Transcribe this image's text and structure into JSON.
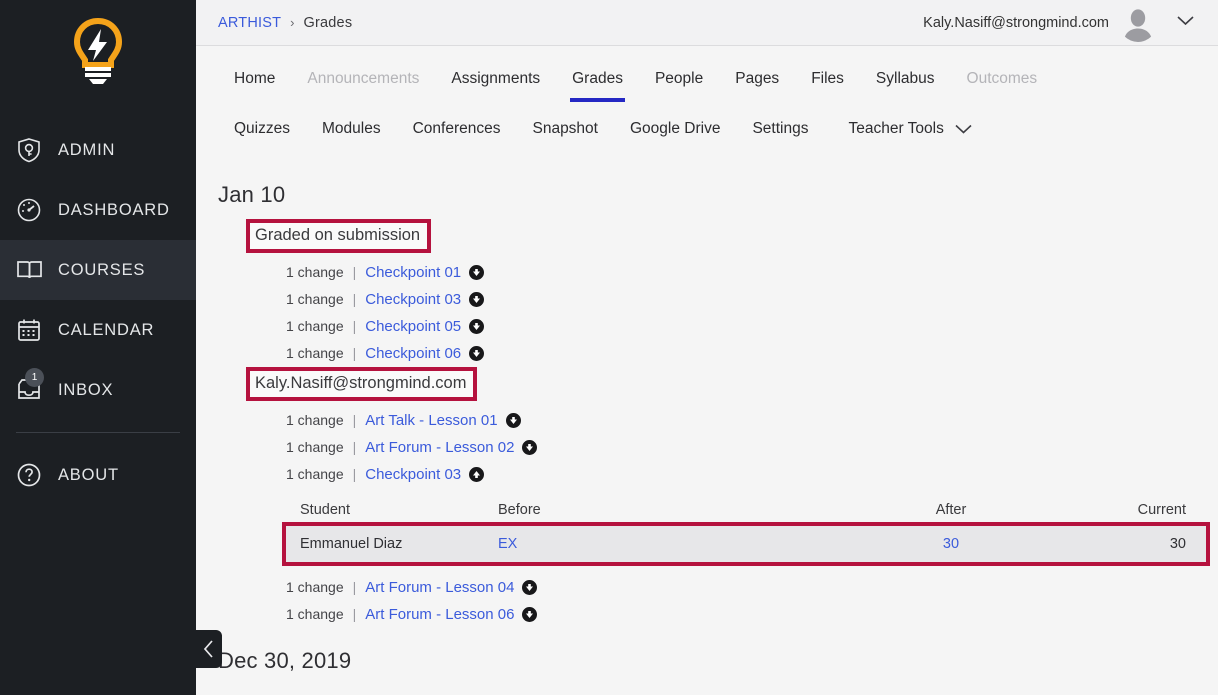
{
  "sidebar": {
    "logo_name": "lightbulb-logo",
    "items": [
      {
        "label": "ADMIN",
        "icon": "shield-key-icon",
        "active": false,
        "badge": null
      },
      {
        "label": "DASHBOARD",
        "icon": "gauge-icon",
        "active": false,
        "badge": null
      },
      {
        "label": "COURSES",
        "icon": "book-icon",
        "active": true,
        "badge": null
      },
      {
        "label": "CALENDAR",
        "icon": "calendar-icon",
        "active": false,
        "badge": null
      },
      {
        "label": "INBOX",
        "icon": "inbox-tray-icon",
        "active": false,
        "badge": "1"
      },
      {
        "label": "ABOUT",
        "icon": "question-circle-icon",
        "active": false,
        "badge": null
      }
    ],
    "collapse_label": "collapse-sidebar"
  },
  "topbar": {
    "breadcrumb_root": "ARTHIST",
    "breadcrumb_sep": "›",
    "breadcrumb_current": "Grades",
    "user_email": "Kaly.Nasiff@strongmind.com"
  },
  "coursenav": {
    "row1": [
      {
        "label": "Home",
        "state": "normal"
      },
      {
        "label": "Announcements",
        "state": "muted"
      },
      {
        "label": "Assignments",
        "state": "normal"
      },
      {
        "label": "Grades",
        "state": "active"
      },
      {
        "label": "People",
        "state": "normal"
      },
      {
        "label": "Pages",
        "state": "normal"
      },
      {
        "label": "Files",
        "state": "normal"
      },
      {
        "label": "Syllabus",
        "state": "normal"
      },
      {
        "label": "Outcomes",
        "state": "muted"
      }
    ],
    "row2": [
      {
        "label": "Quizzes",
        "state": "normal"
      },
      {
        "label": "Modules",
        "state": "normal"
      },
      {
        "label": "Conferences",
        "state": "normal"
      },
      {
        "label": "Snapshot",
        "state": "normal"
      },
      {
        "label": "Google Drive",
        "state": "normal"
      },
      {
        "label": "Settings",
        "state": "normal"
      }
    ],
    "teacher_tools": "Teacher Tools"
  },
  "content": {
    "day1_heading": "Jan 10",
    "group1_title": "Graded on submission",
    "group1_rows": [
      {
        "count": "1 change",
        "pipe": "|",
        "link": "Checkpoint 01",
        "arrow": "down"
      },
      {
        "count": "1 change",
        "pipe": "|",
        "link": "Checkpoint 03",
        "arrow": "down"
      },
      {
        "count": "1 change",
        "pipe": "|",
        "link": "Checkpoint 05",
        "arrow": "down"
      },
      {
        "count": "1 change",
        "pipe": "|",
        "link": "Checkpoint 06",
        "arrow": "down"
      }
    ],
    "group2_title": "Kaly.Nasiff@strongmind.com",
    "group2_rows_top": [
      {
        "count": "1 change",
        "pipe": "|",
        "link": "Art Talk - Lesson 01",
        "arrow": "down"
      },
      {
        "count": "1 change",
        "pipe": "|",
        "link": "Art Forum - Lesson 02",
        "arrow": "down"
      },
      {
        "count": "1 change",
        "pipe": "|",
        "link": "Checkpoint 03",
        "arrow": "up"
      }
    ],
    "table": {
      "headers": [
        "Student",
        "Before",
        "After",
        "Current"
      ],
      "rows": [
        {
          "student": "Emmanuel Diaz",
          "before": "EX",
          "after": "30",
          "current": "30"
        }
      ]
    },
    "group2_rows_bottom": [
      {
        "count": "1 change",
        "pipe": "|",
        "link": "Art Forum - Lesson 04",
        "arrow": "down"
      },
      {
        "count": "1 change",
        "pipe": "|",
        "link": "Art Forum - Lesson 06",
        "arrow": "down"
      }
    ],
    "day2_heading": "Dec 30, 2019"
  },
  "colors": {
    "sidebar_bg": "#1c1f23",
    "accent_blue": "#3b5bdb",
    "active_tab_underline": "#2528c4",
    "highlight_red": "#b5123e",
    "logo_orange": "#f5a31a"
  }
}
